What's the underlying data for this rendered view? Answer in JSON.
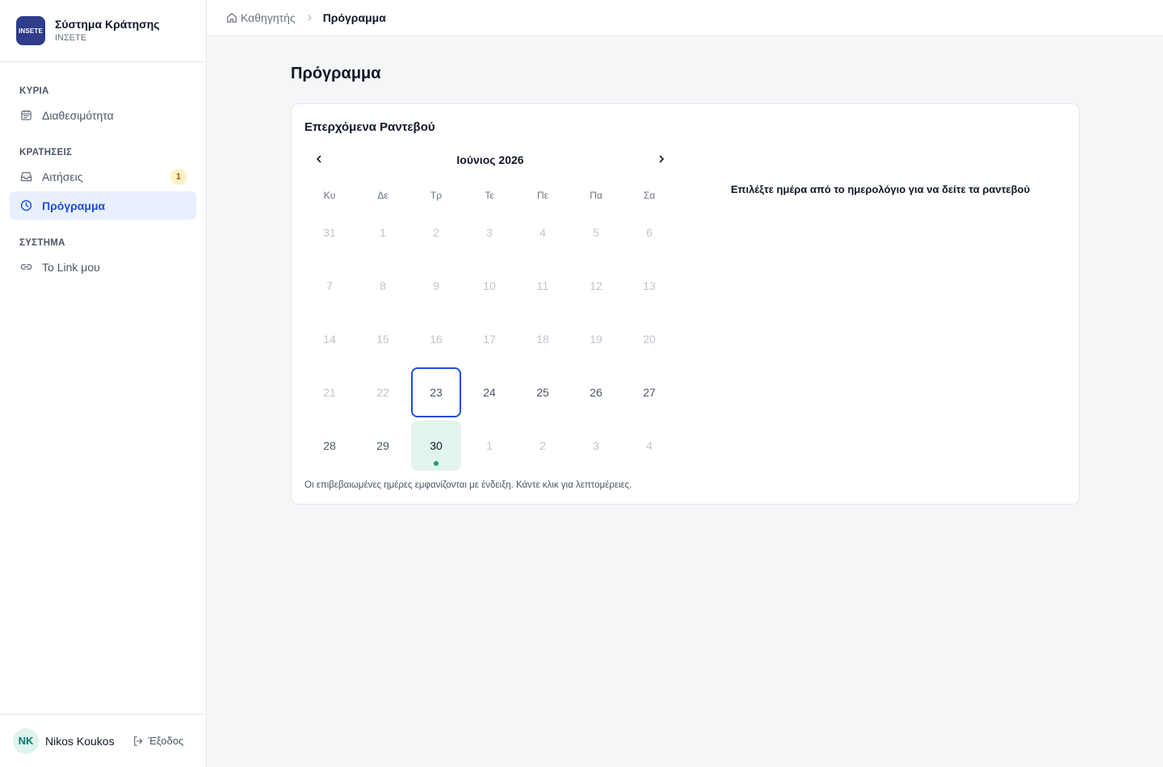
{
  "brand": {
    "logo_text": "INSETE",
    "title": "Σύστημα Κράτησης",
    "subtitle": "ΙΝΣΕΤΕ"
  },
  "sidebar": {
    "sections": [
      {
        "label": "ΚΥΡΙΑ",
        "items": [
          {
            "label": "Διαθεσιμότητα",
            "icon": "calendar-icon"
          }
        ]
      },
      {
        "label": "ΚΡΑΤΗΣΕΙΣ",
        "items": [
          {
            "label": "Αιτήσεις",
            "icon": "inbox-icon",
            "badge": "1"
          },
          {
            "label": "Πρόγραμμα",
            "icon": "clock-icon",
            "active": true
          }
        ]
      },
      {
        "label": "ΣΥΣΤΗΜΑ",
        "items": [
          {
            "label": "Το Link μου",
            "icon": "link-icon"
          }
        ]
      }
    ]
  },
  "user": {
    "initials": "NK",
    "name": "Nikos Koukos",
    "logout_label": "Έξοδος"
  },
  "breadcrumb": {
    "home": "Καθηγητής",
    "current": "Πρόγραμμα"
  },
  "page": {
    "title": "Πρόγραμμα"
  },
  "card": {
    "title": "Επερχόμενα Ραντεβού",
    "month_label": "Ιούνιος 2026",
    "weekdays": [
      "Κυ",
      "Δε",
      "Τρ",
      "Τε",
      "Πε",
      "Πα",
      "Σα"
    ],
    "weeks": [
      [
        "31",
        "1",
        "2",
        "3",
        "4",
        "5",
        "6"
      ],
      [
        "7",
        "8",
        "9",
        "10",
        "11",
        "12",
        "13"
      ],
      [
        "14",
        "15",
        "16",
        "17",
        "18",
        "19",
        "20"
      ],
      [
        "21",
        "22",
        "23",
        "24",
        "25",
        "26",
        "27"
      ],
      [
        "28",
        "29",
        "30",
        "1",
        "2",
        "3",
        "4"
      ]
    ],
    "today": "23",
    "confirmed_days": [
      "30"
    ],
    "note": "Οι επιβεβαιωμένες ημέρες εμφανίζονται με ένδειξη. Κάντε κλικ για λεπτομέρειες.",
    "detail_hint": "Επιλέξτε ημέρα από το ημερολόγιο για να δείτε τα ραντεβού"
  },
  "colors": {
    "accent": "#1d4ed8",
    "active_bg": "#e8efff",
    "confirmed_bg": "#e3f4ee",
    "confirmed_dot": "#16a36a",
    "badge_bg": "#fdf1c5",
    "logo_bg": "#2f3c8a"
  }
}
